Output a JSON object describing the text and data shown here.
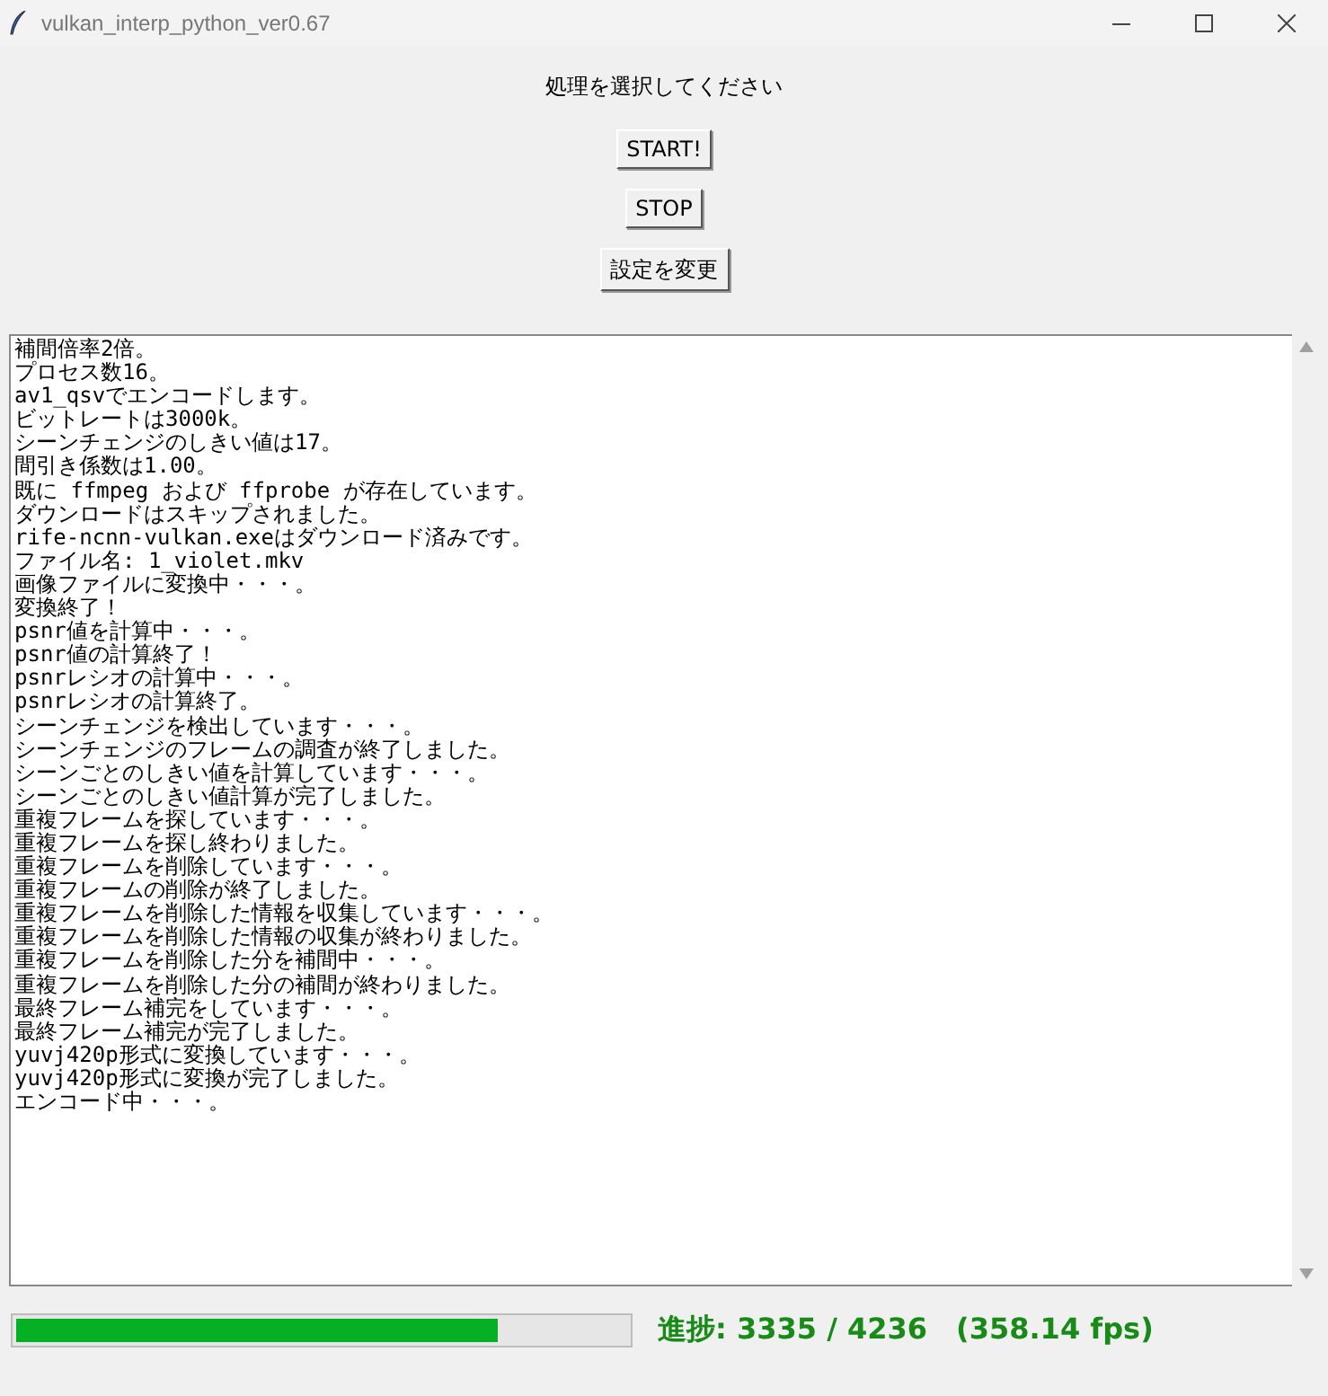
{
  "window": {
    "title": "vulkan_interp_python_ver0.67"
  },
  "prompt": "処理を選択してください",
  "buttons": [
    "START!",
    "STOP",
    "設定を変更"
  ],
  "log": [
    "補間倍率2倍。",
    "プロセス数16。",
    "av1_qsvでエンコードします。",
    "ビットレートは3000k。",
    "シーンチェンジのしきい値は17。",
    "間引き係数は1.00。",
    "既に ffmpeg および ffprobe が存在しています。",
    "ダウンロードはスキップされました。",
    "rife-ncnn-vulkan.exeはダウンロード済みです。",
    "ファイル名: 1_violet.mkv",
    "画像ファイルに変換中・・・。",
    "変換終了！",
    "psnr値を計算中・・・。",
    "psnr値の計算終了！",
    "psnrレシオの計算中・・・。",
    "psnrレシオの計算終了。",
    "シーンチェンジを検出しています・・・。",
    "シーンチェンジのフレームの調査が終了しました。",
    "シーンごとのしきい値を計算しています・・・。",
    "シーンごとのしきい値計算が完了しました。",
    "重複フレームを探しています・・・。",
    "重複フレームを探し終わりました。",
    "重複フレームを削除しています・・・。",
    "重複フレームの削除が終了しました。",
    "重複フレームを削除した情報を収集しています・・・。",
    "重複フレームを削除した情報の収集が終わりました。",
    "重複フレームを削除した分を補間中・・・。",
    "重複フレームを削除した分の補間が終わりました。",
    "最終フレーム補完をしています・・・。",
    "最終フレーム補完が完了しました。",
    "yuvj420p形式に変換しています・・・。",
    "yuvj420p形式に変換が完了しました。",
    "エンコード中・・・。"
  ],
  "progress": {
    "level": 0.787,
    "label": "進捗: 3335 / 4236　(358.14 fps)"
  }
}
